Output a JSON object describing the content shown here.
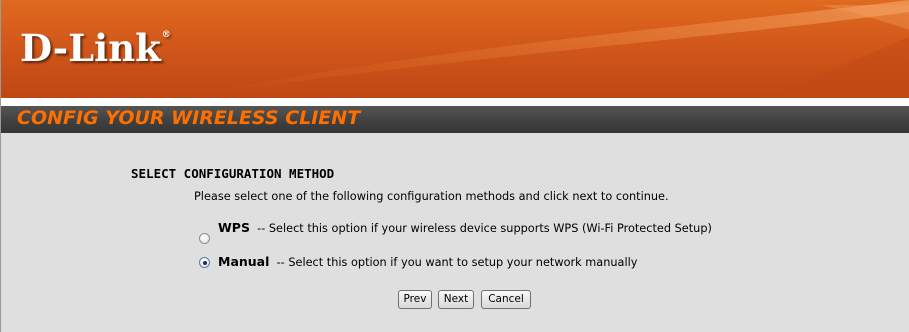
{
  "brand": {
    "logo_text": "D-Link",
    "logo_mark": "®"
  },
  "page": {
    "title": "CONFIG YOUR WIRELESS CLIENT"
  },
  "section": {
    "title": "SELECT CONFIGURATION METHOD",
    "instructions": "Please select one of the following configuration methods and click next to continue."
  },
  "options": [
    {
      "name": "WPS",
      "description": "-- Select this option if your wireless device supports WPS (Wi-Fi Protected Setup)",
      "selected": false
    },
    {
      "name": "Manual",
      "description": "-- Select this option if you want to setup your network manually",
      "selected": true
    }
  ],
  "buttons": {
    "prev": "Prev",
    "next": "Next",
    "cancel": "Cancel"
  },
  "colors": {
    "banner_orange": "#d0561a",
    "title_text": "#ff6f00",
    "title_bar": "#3f3f3f",
    "background": "#dfdfdf"
  }
}
